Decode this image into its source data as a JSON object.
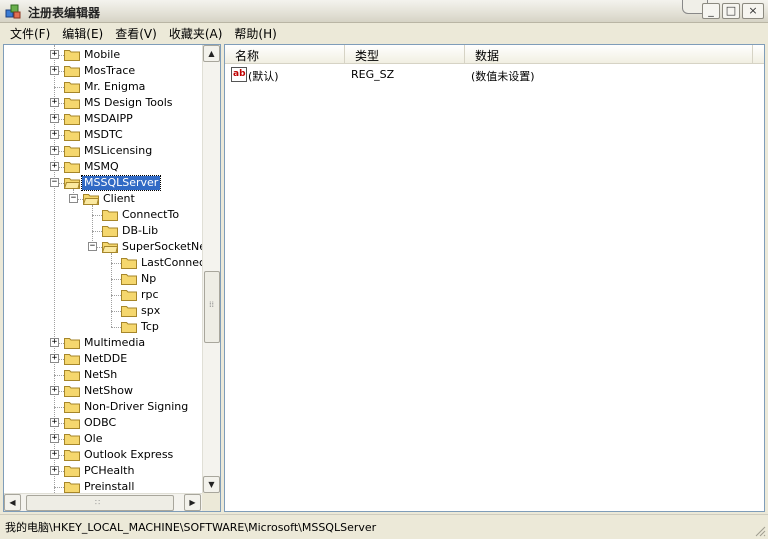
{
  "window": {
    "title": "注册表编辑器",
    "minimize": "_",
    "maximize": "□",
    "close": "×"
  },
  "menu": [
    {
      "label": "文件(F)"
    },
    {
      "label": "编辑(E)"
    },
    {
      "label": "查看(V)"
    },
    {
      "label": "收藏夹(A)"
    },
    {
      "label": "帮助(H)"
    }
  ],
  "tree": {
    "items": [
      {
        "label": "Mobile",
        "depth": 0,
        "expander": "+"
      },
      {
        "label": "MosTrace",
        "depth": 0,
        "expander": "+"
      },
      {
        "label": "Mr. Enigma",
        "depth": 0,
        "expander": ""
      },
      {
        "label": "MS Design Tools",
        "depth": 0,
        "expander": "+"
      },
      {
        "label": "MSDAIPP",
        "depth": 0,
        "expander": "+"
      },
      {
        "label": "MSDTC",
        "depth": 0,
        "expander": "+"
      },
      {
        "label": "MSLicensing",
        "depth": 0,
        "expander": "+"
      },
      {
        "label": "MSMQ",
        "depth": 0,
        "expander": "+"
      },
      {
        "label": "MSSQLServer",
        "depth": 0,
        "expander": "-",
        "selected": true
      },
      {
        "label": "Client",
        "depth": 1,
        "expander": "-"
      },
      {
        "label": "ConnectTo",
        "depth": 2,
        "expander": ""
      },
      {
        "label": "DB-Lib",
        "depth": 2,
        "expander": ""
      },
      {
        "label": "SuperSocketNetL",
        "depth": 2,
        "expander": "-"
      },
      {
        "label": "LastConnect",
        "depth": 3,
        "expander": ""
      },
      {
        "label": "Np",
        "depth": 3,
        "expander": ""
      },
      {
        "label": "rpc",
        "depth": 3,
        "expander": ""
      },
      {
        "label": "spx",
        "depth": 3,
        "expander": ""
      },
      {
        "label": "Tcp",
        "depth": 3,
        "expander": ""
      },
      {
        "label": "Multimedia",
        "depth": 0,
        "expander": "+"
      },
      {
        "label": "NetDDE",
        "depth": 0,
        "expander": "+"
      },
      {
        "label": "NetSh",
        "depth": 0,
        "expander": ""
      },
      {
        "label": "NetShow",
        "depth": 0,
        "expander": "+"
      },
      {
        "label": "Non-Driver Signing",
        "depth": 0,
        "expander": ""
      },
      {
        "label": "ODBC",
        "depth": 0,
        "expander": "+"
      },
      {
        "label": "Ole",
        "depth": 0,
        "expander": "+"
      },
      {
        "label": "Outlook Express",
        "depth": 0,
        "expander": "+"
      },
      {
        "label": "PCHealth",
        "depth": 0,
        "expander": "+"
      },
      {
        "label": "Preinstall",
        "depth": 0,
        "expander": ""
      }
    ]
  },
  "list": {
    "columns": [
      {
        "label": "名称"
      },
      {
        "label": "类型"
      },
      {
        "label": "数据"
      }
    ],
    "rows": [
      {
        "icon": "ab",
        "name": "(默认)",
        "type": "REG_SZ",
        "data": "(数值未设置)"
      }
    ]
  },
  "status": {
    "path": "我的电脑\\HKEY_LOCAL_MACHINE\\SOFTWARE\\Microsoft\\MSSQLServer"
  },
  "colors": {
    "selection": "#316ac5",
    "folder": "#f5d76e",
    "border": "#7f9db9"
  }
}
